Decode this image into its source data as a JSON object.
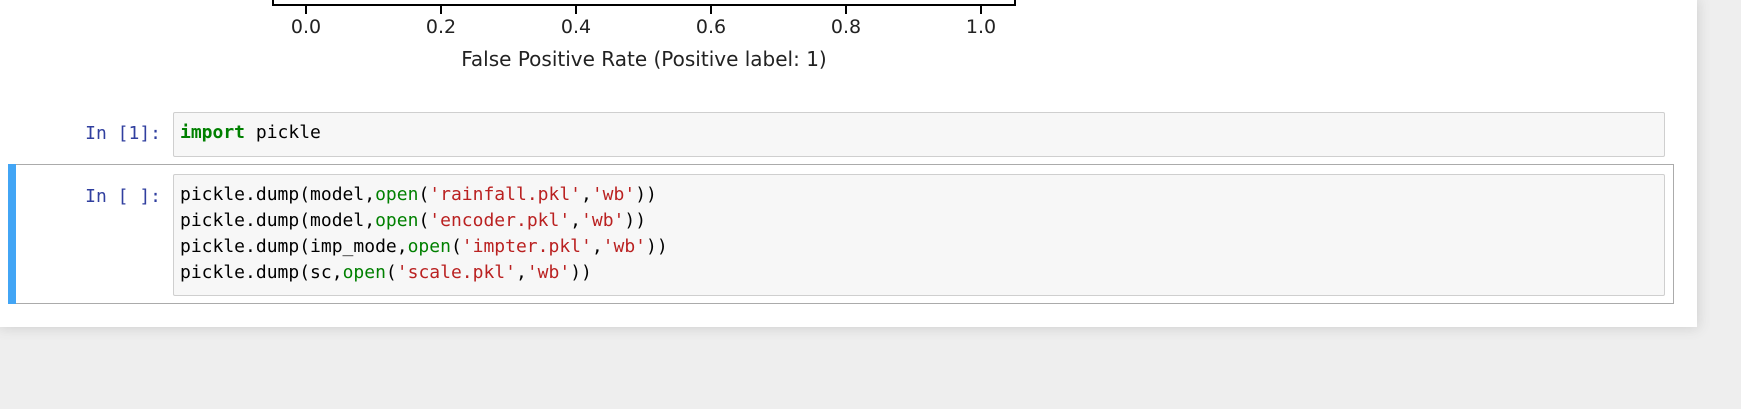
{
  "chart_data": {
    "type": "line",
    "xlabel": "False Positive Rate (Positive label: 1)",
    "xticks": [
      "0.0",
      "0.2",
      "0.4",
      "0.6",
      "0.8",
      "1.0"
    ],
    "xlim": [
      -0.05,
      1.05
    ]
  },
  "cells": [
    {
      "prompt": "In [1]:",
      "lines": [
        [
          {
            "t": "import",
            "c": "kw"
          },
          {
            "t": " pickle",
            "c": ""
          }
        ]
      ]
    },
    {
      "prompt": "In [ ]:",
      "lines": [
        [
          {
            "t": "pickle.dump(model,",
            "c": ""
          },
          {
            "t": "open",
            "c": "bi"
          },
          {
            "t": "(",
            "c": ""
          },
          {
            "t": "'rainfall.pkl'",
            "c": "str"
          },
          {
            "t": ",",
            "c": ""
          },
          {
            "t": "'wb'",
            "c": "str"
          },
          {
            "t": "))",
            "c": ""
          }
        ],
        [
          {
            "t": "pickle.dump(model,",
            "c": ""
          },
          {
            "t": "open",
            "c": "bi"
          },
          {
            "t": "(",
            "c": ""
          },
          {
            "t": "'encoder.pkl'",
            "c": "str"
          },
          {
            "t": ",",
            "c": ""
          },
          {
            "t": "'wb'",
            "c": "str"
          },
          {
            "t": "))",
            "c": ""
          }
        ],
        [
          {
            "t": "pickle.dump(imp_mode,",
            "c": ""
          },
          {
            "t": "open",
            "c": "bi"
          },
          {
            "t": "(",
            "c": ""
          },
          {
            "t": "'impter.pkl'",
            "c": "str"
          },
          {
            "t": ",",
            "c": ""
          },
          {
            "t": "'wb'",
            "c": "str"
          },
          {
            "t": "))",
            "c": ""
          }
        ],
        [
          {
            "t": "pickle.dump(sc,",
            "c": ""
          },
          {
            "t": "open",
            "c": "bi"
          },
          {
            "t": "(",
            "c": ""
          },
          {
            "t": "'scale.pkl'",
            "c": "str"
          },
          {
            "t": ",",
            "c": ""
          },
          {
            "t": "'wb'",
            "c": "str"
          },
          {
            "t": "))",
            "c": ""
          }
        ]
      ]
    }
  ]
}
